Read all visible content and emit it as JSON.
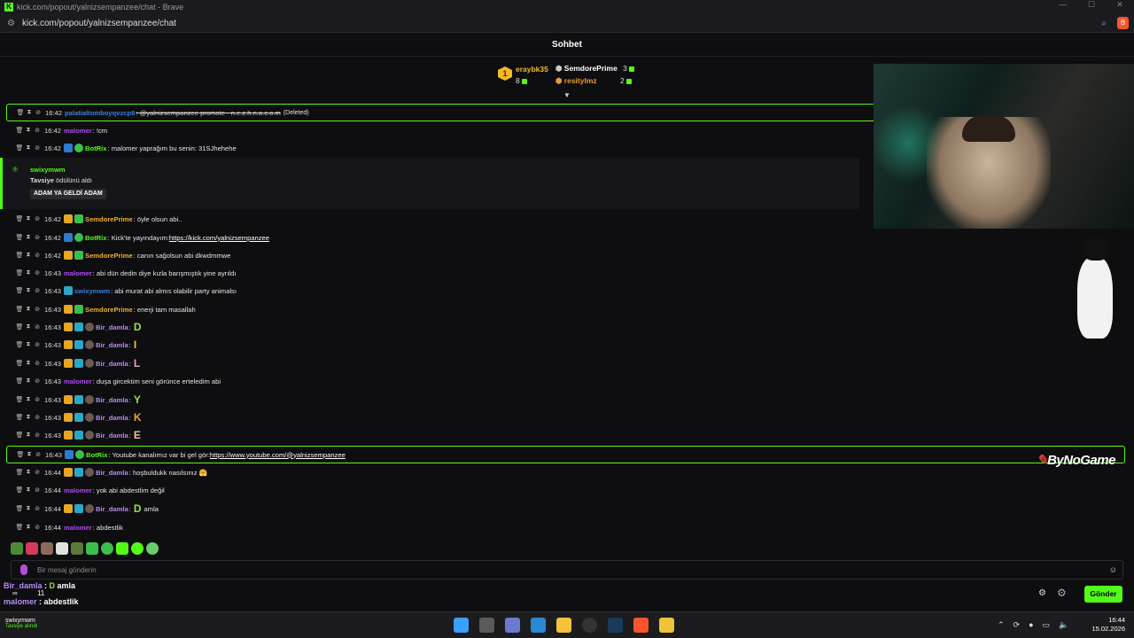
{
  "window": {
    "title": "kick.com/popout/yalnizsempanzee/chat - Brave",
    "url": "kick.com/popout/yalnizsempanzee/chat"
  },
  "chat_header": {
    "title": "Sohbet"
  },
  "leaderboard": {
    "first": {
      "name": "eraybk35",
      "count": "8"
    },
    "second": {
      "name": "SemdorePrime",
      "count": "3"
    },
    "third": {
      "name": "resitylmz",
      "count": "2"
    }
  },
  "messages": [
    {
      "time": "16:42",
      "user": "palatialtomboyqvzcp8",
      "text": ": @yalnizsempanzee promote - n.e.z.h.n.a.c.o.m",
      "deleted": "(Deleted)",
      "color": "#3b7ddd"
    },
    {
      "time": "16:42",
      "user": "malomer",
      "text": ": !cm",
      "color": "#b04cf0"
    },
    {
      "time": "16:42",
      "user": "BotRix",
      "text": ": malomer yaprağım bu senin: 31SJhehehe",
      "color": "#53fc18"
    },
    {
      "time": "16:42",
      "user": "SemdorePrime",
      "text": ": öyle olsun abi..",
      "color": "#f0b030"
    },
    {
      "time": "16:42",
      "user": "BotRix",
      "text": ": Kick'te yayındayım: ",
      "link": "https://kick.com/yalnizsempanzee",
      "color": "#53fc18"
    },
    {
      "time": "16:42",
      "user": "SemdorePrime",
      "text": ": canın sağolsun abi dkwdmmwe",
      "color": "#f0b030"
    },
    {
      "time": "16:43",
      "user": "malomer",
      "text": ": abi dün dedin diye kızla barışmıştık yine ayrıldı",
      "color": "#b04cf0"
    },
    {
      "time": "16:43",
      "user": "swixymwm",
      "text": ": abi murat abi almıs olabilir party animalsı",
      "color": "#3b7ddd"
    },
    {
      "time": "16:43",
      "user": "SemdorePrime",
      "text": ": enerji tam masallah",
      "color": "#f0b030"
    },
    {
      "time": "16:43",
      "user": "Bir_damla",
      "text": ":",
      "emote": "D",
      "emote_color": "#9be04a",
      "color": "#b78cf3"
    },
    {
      "time": "16:43",
      "user": "Bir_damla",
      "text": ":",
      "emote": "I",
      "emote_color": "#f0c24a",
      "color": "#b78cf3"
    },
    {
      "time": "16:43",
      "user": "Bir_damla",
      "text": ":",
      "emote": "L",
      "emote_color": "#e8a0d0",
      "color": "#b78cf3"
    },
    {
      "time": "16:43",
      "user": "malomer",
      "text": ": duşa gircektim seni görünce erteledim abi",
      "color": "#b04cf0"
    },
    {
      "time": "16:43",
      "user": "Bir_damla",
      "text": ":",
      "emote": "Y",
      "emote_color": "#9be04a",
      "color": "#b78cf3"
    },
    {
      "time": "16:43",
      "user": "Bir_damla",
      "text": ":",
      "emote": "K",
      "emote_color": "#f0a040",
      "color": "#b78cf3"
    },
    {
      "time": "16:43",
      "user": "Bir_damla",
      "text": ":",
      "emote": "E",
      "emote_color": "#f0c0a0",
      "color": "#b78cf3"
    },
    {
      "time": "16:43",
      "user": "BotRix",
      "text": ": Youtube kanalımız var bi gel gör: ",
      "link": "https://www.youtube.com/@yalnizsempanzee",
      "color": "#53fc18"
    },
    {
      "time": "16:44",
      "user": "Bir_damla",
      "text": ": hoşbuldukk nasılsınız 🤗",
      "color": "#b78cf3"
    },
    {
      "time": "16:44",
      "user": "malomer",
      "text": ": yok abi abdestlim değil",
      "color": "#b04cf0"
    },
    {
      "time": "16:44",
      "user": "Bir_damla",
      "text": ":",
      "emote": "D",
      "emote_color": "#9be04a",
      "extra": "amla",
      "color": "#b78cf3"
    },
    {
      "time": "16:44",
      "user": "malomer",
      "text": ": abdestlik",
      "color": "#b04cf0"
    }
  ],
  "reward": {
    "user": "swixymwm",
    "label_bold": "Tavsiye",
    "label_rest": " ödülünü aldı",
    "pill": "ADAM YA GELDİ ADAM"
  },
  "watermark": {
    "text": "ByNoGame"
  },
  "input": {
    "placeholder": "Bir mesaj gönderin"
  },
  "send_button": "Gönder",
  "overlay": {
    "user1": "Bir_damla",
    "sep": " : ",
    "emote": "D",
    "text1": " amla",
    "stat1": "∞",
    "stat2": "11",
    "user2": "malomer",
    "text2": " : abdestlik"
  },
  "taskbar": {
    "account_name": "swixymwm",
    "account_status": "Tavsiye alındı",
    "time": "16:44",
    "date": "15.02.2026"
  },
  "colors": {
    "accent": "#53fc18",
    "background": "#0e0e10"
  }
}
